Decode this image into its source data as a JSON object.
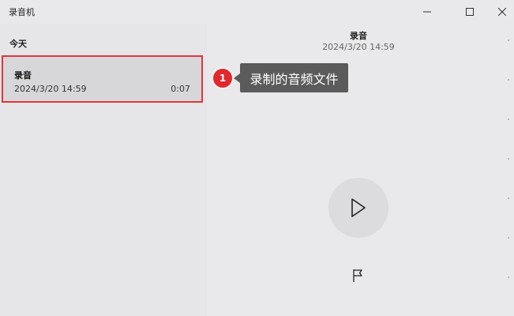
{
  "window": {
    "title": "录音机"
  },
  "sidebar": {
    "section": "今天",
    "items": [
      {
        "name": "录音",
        "date": "2024/3/20 14:59",
        "duration": "0:07"
      }
    ]
  },
  "callout": {
    "number": "1",
    "text": "录制的音频文件"
  },
  "player": {
    "name": "录音",
    "date": "2024/3/20 14:59"
  },
  "icons": {
    "minimize": "minimize-icon",
    "maximize": "maximize-icon",
    "close": "close-icon",
    "play": "play-icon",
    "flag": "flag-icon"
  },
  "colors": {
    "highlight_border": "#e0363b",
    "badge": "#e2282d",
    "callout_bg": "#5b5b5b",
    "selected_item_bg": "#d7d7d9"
  }
}
